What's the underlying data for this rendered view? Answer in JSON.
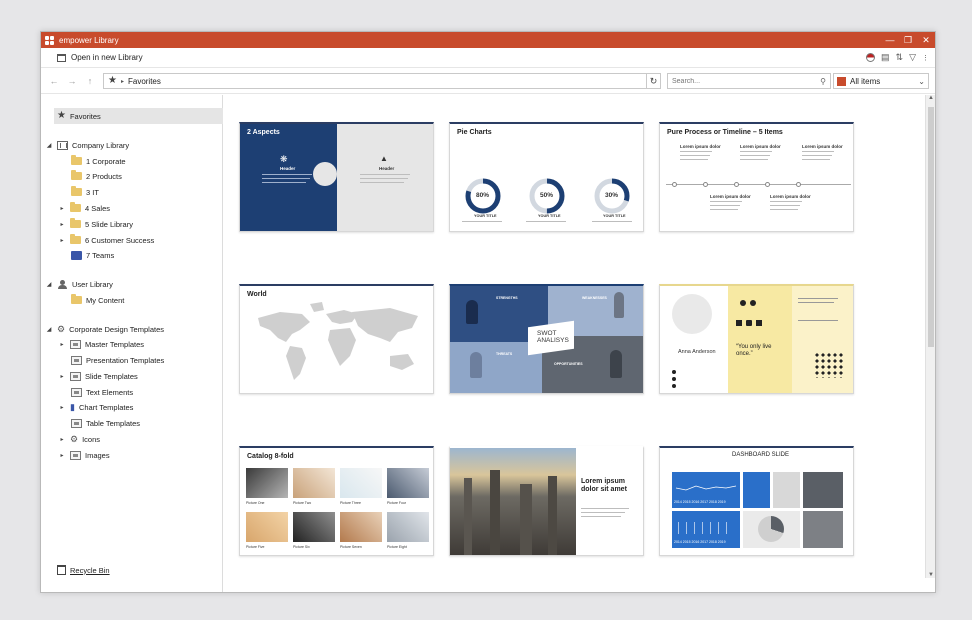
{
  "window": {
    "title": "empower Library"
  },
  "toolbar": {
    "open_new": "Open in new Library"
  },
  "address": {
    "path": "Favorites"
  },
  "search": {
    "placeholder": "Search..."
  },
  "filter": {
    "selected": "All items"
  },
  "sidebar": {
    "favorites": "Favorites",
    "company_library": "Company Library",
    "company_items": [
      "1 Corporate",
      "2 Products",
      "3 IT",
      "4 Sales",
      "5 Slide Library",
      "6 Customer Success",
      "7 Teams"
    ],
    "user_library": "User Library",
    "user_items": [
      "My Content"
    ],
    "corporate_design": "Corporate Design Templates",
    "design_items": [
      "Master Templates",
      "Presentation Templates",
      "Slide Templates",
      "Text Elements",
      "Chart Templates",
      "Table Templates",
      "Icons",
      "Images"
    ],
    "recycle_bin": "Recycle Bin"
  },
  "cards": {
    "aspects": {
      "title": "2 Aspects",
      "header1": "Header",
      "header2": "Header"
    },
    "pie": {
      "title": "Pie Charts",
      "values": [
        "80%",
        "50%",
        "30%"
      ],
      "fractions": [
        0.8,
        0.5,
        0.3
      ],
      "label": "YOUR TITLE"
    },
    "process": {
      "title": "Pure Process or Timeline – 5 Items",
      "item": "Lorem ipsum dolor"
    },
    "world": {
      "title": "World"
    },
    "swot": {
      "center": "SWOT ANALISYS",
      "labels": [
        "STRENGTHS",
        "WEAKNESSES",
        "THREATS",
        "OPPORTUNITIES"
      ]
    },
    "profile": {
      "name": "Anna Anderson",
      "quote": "“You only live once.”"
    },
    "catalog": {
      "title": "Catalog 8-fold",
      "captions": [
        "Picture One",
        "Picture Two",
        "Picture Three",
        "Picture Four",
        "Picture Five",
        "Picture Six",
        "Picture Seven",
        "Picture Eight"
      ]
    },
    "city": {
      "headline": "Lorem ipsum dolor sit amet"
    },
    "dashboard": {
      "title": "DASHBOARD SLIDE",
      "years": "2014 2015 2016 2017 2018 2019"
    }
  },
  "colors": {
    "titlebar": "#c84b2c",
    "navy": "#1d3f73",
    "accent_blue": "#2a6fc9"
  }
}
